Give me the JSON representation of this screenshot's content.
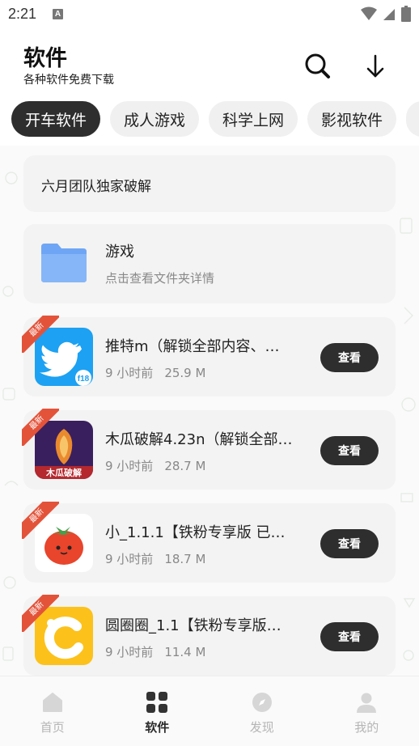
{
  "status_bar": {
    "time": "2:21",
    "notif_letter": "A"
  },
  "header": {
    "title": "软件",
    "subtitle": "各种软件免费下载"
  },
  "icons": {
    "search": "search-icon",
    "download": "download-icon"
  },
  "chips": [
    {
      "label": "开车软件",
      "active": true
    },
    {
      "label": "成人游戏",
      "active": false
    },
    {
      "label": "科学上网",
      "active": false
    },
    {
      "label": "影视软件",
      "active": false
    }
  ],
  "notice": {
    "text": "六月团队独家破解"
  },
  "folder": {
    "title": "游戏",
    "subtitle": "点击查看文件夹详情"
  },
  "items": [
    {
      "badge": "最新",
      "title": "推特m（解锁全部内容、…",
      "time": "9 小时前",
      "size": "25.9 M",
      "button": "查看",
      "icon": "twitter-icon",
      "icon_badge": "f18"
    },
    {
      "badge": "最新",
      "title": "木瓜破解4.23n（解锁全部…",
      "time": "9 小时前",
      "size": "28.7 M",
      "button": "查看",
      "icon": "mugua-icon",
      "icon_text": "木瓜破解"
    },
    {
      "badge": "最新",
      "title": "小_1.1.1【铁粉专享版 已…",
      "time": "9 小时前",
      "size": "18.7 M",
      "button": "查看",
      "icon": "tomato-icon"
    },
    {
      "badge": "最新",
      "title": "圆圈圈_1.1【铁粉专享版…",
      "time": "9 小时前",
      "size": "11.4 M",
      "button": "查看",
      "icon": "circle-c-icon"
    }
  ],
  "nav": [
    {
      "label": "首页",
      "icon": "home-icon",
      "active": false
    },
    {
      "label": "软件",
      "icon": "apps-grid-icon",
      "active": true
    },
    {
      "label": "发现",
      "icon": "compass-icon",
      "active": false
    },
    {
      "label": "我的",
      "icon": "profile-icon",
      "active": false
    }
  ],
  "colors": {
    "accent_dark": "#2e2e2e",
    "ribbon": "#e3533a",
    "folder": "#6ea6f5",
    "twitter": "#1da1f2"
  }
}
